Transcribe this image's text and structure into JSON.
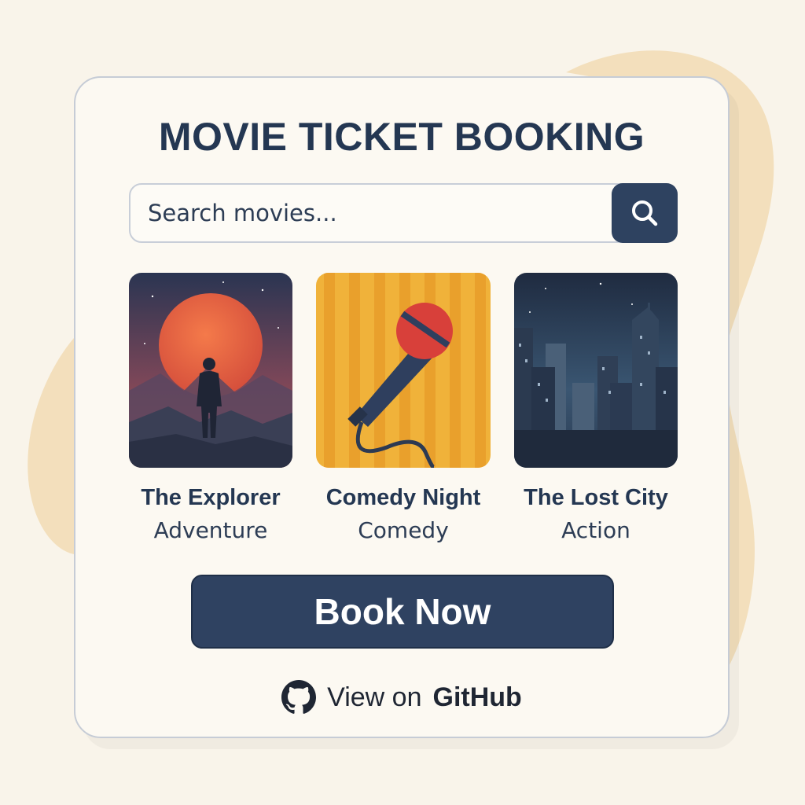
{
  "app": {
    "title": "MOVIE TICKET BOOKING"
  },
  "search": {
    "placeholder": "Search movies...",
    "value": "",
    "button_icon": "search-icon"
  },
  "movies": [
    {
      "title": "The Explorer",
      "genre": "Adventure",
      "poster_icon": "explorer-poster"
    },
    {
      "title": "Comedy Night",
      "genre": "Comedy",
      "poster_icon": "microphone-poster"
    },
    {
      "title": "The Lost City",
      "genre": "Action",
      "poster_icon": "city-skyline-poster"
    }
  ],
  "book_button": {
    "label": "Book Now"
  },
  "github": {
    "prefix": "View on",
    "name": "GitHub",
    "icon": "github-icon"
  },
  "colors": {
    "background": "#f9f4ea",
    "blob": "#f3dfbc",
    "card": "#fcf9f2",
    "primary": "#2f4261",
    "text": "#243752"
  }
}
